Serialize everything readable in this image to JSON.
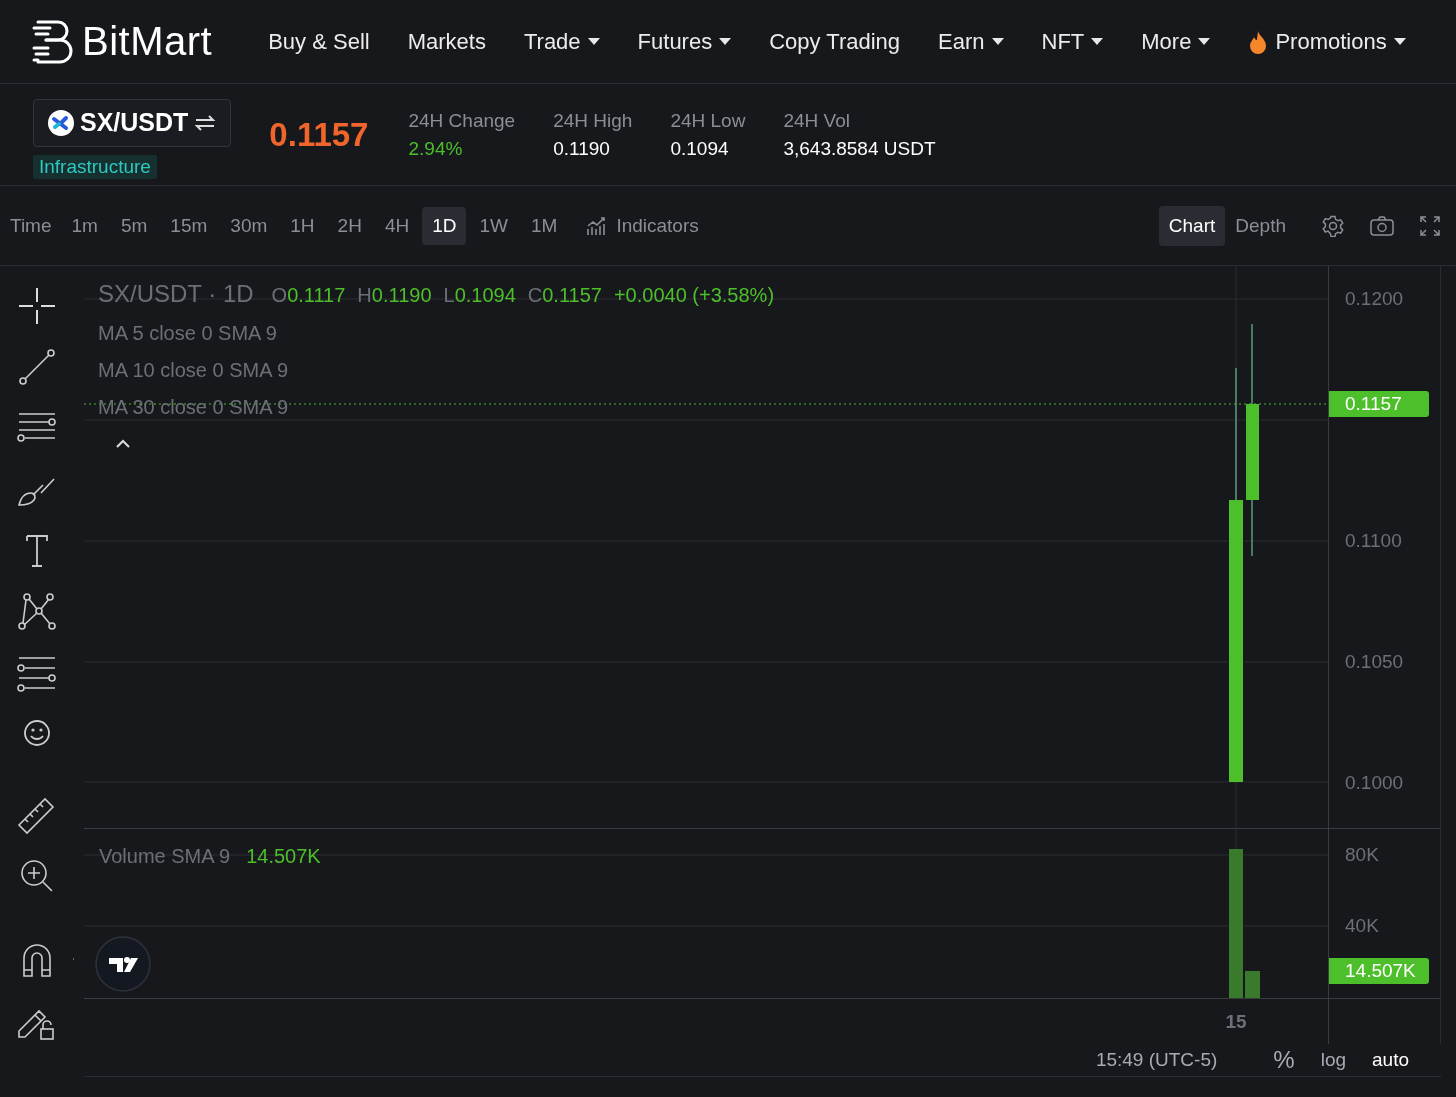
{
  "nav": {
    "brand": "BitMart",
    "items": [
      {
        "label": "Buy & Sell",
        "kind": "link",
        "dropdown": false
      },
      {
        "label": "Markets",
        "kind": "link",
        "dropdown": false
      },
      {
        "label": "Trade",
        "kind": "link",
        "dropdown": true
      },
      {
        "label": "Futures",
        "kind": "link",
        "dropdown": true
      },
      {
        "label": "Copy Trading",
        "kind": "link",
        "dropdown": false
      },
      {
        "label": "Earn",
        "kind": "link",
        "dropdown": true
      },
      {
        "label": "NFT",
        "kind": "link",
        "dropdown": true
      },
      {
        "label": "More",
        "kind": "link",
        "dropdown": true
      },
      {
        "label": "Promotions",
        "kind": "promo",
        "dropdown": true
      }
    ]
  },
  "ticker": {
    "pair": "SX/USDT",
    "tag": "Infrastructure",
    "price": "0.1157",
    "stats": [
      {
        "label": "24H Change",
        "value": "2.94%",
        "kind": "change"
      },
      {
        "label": "24H High",
        "value": "0.1190",
        "kind": "plain"
      },
      {
        "label": "24H Low",
        "value": "0.1094",
        "kind": "plain"
      },
      {
        "label": "24H Vol",
        "value": "3,643.8584 USDT",
        "kind": "plain"
      }
    ]
  },
  "toolbar": {
    "time_label": "Time",
    "intervals": [
      {
        "label": "1m",
        "selected": false
      },
      {
        "label": "5m",
        "selected": false
      },
      {
        "label": "15m",
        "selected": false
      },
      {
        "label": "30m",
        "selected": false
      },
      {
        "label": "1H",
        "selected": false
      },
      {
        "label": "2H",
        "selected": false
      },
      {
        "label": "4H",
        "selected": false
      },
      {
        "label": "1D",
        "selected": true
      },
      {
        "label": "1W",
        "selected": false
      },
      {
        "label": "1M",
        "selected": false
      }
    ],
    "indicators": "Indicators",
    "views": [
      {
        "label": "Chart",
        "selected": true
      },
      {
        "label": "Depth",
        "selected": false
      }
    ]
  },
  "chart": {
    "legend": {
      "title": "SX/USDT · 1D",
      "ohlc": [
        {
          "label": "O",
          "value": "0.1117"
        },
        {
          "label": "H",
          "value": "0.1190"
        },
        {
          "label": "L",
          "value": "0.1094"
        },
        {
          "label": "C",
          "value": "0.1157"
        }
      ],
      "change": "+0.0040 (+3.58%)",
      "ma_lines": [
        "MA 5 close 0 SMA 9",
        "MA 10 close 0 SMA 9",
        "MA 30 close 0 SMA 9"
      ]
    },
    "price_axis": [
      "0.1200",
      "0.1100",
      "0.1050",
      "0.1000"
    ],
    "last_price": "0.1157",
    "volume_legend": {
      "label": "Volume SMA 9",
      "value": "14.507K"
    },
    "volume_axis": [
      "80K",
      "40K"
    ],
    "last_volume": "14.507K",
    "time_axis": [
      "15"
    ],
    "timezone": "15:49 (UTC-5)",
    "scale_options": [
      {
        "label": "%",
        "selected": false
      },
      {
        "label": "log",
        "selected": false
      },
      {
        "label": "auto",
        "selected": true
      }
    ]
  }
}
